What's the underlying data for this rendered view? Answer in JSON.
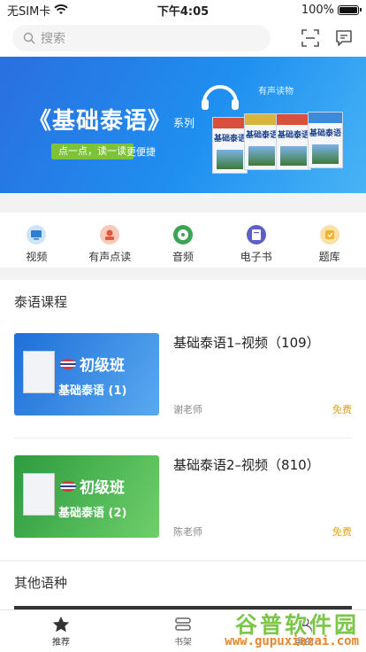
{
  "status": {
    "carrier": "无SIM卡",
    "time": "下午4:05",
    "battery": "100%"
  },
  "search": {
    "placeholder": "搜索"
  },
  "banner": {
    "title": "《基础泰语》",
    "series": "系列",
    "subtitle": "点一点，读一读",
    "easy": "更便捷",
    "audio_label": "有声读物",
    "books": [
      "基础泰语",
      "基础泰语",
      "基础泰语",
      "基础泰语"
    ]
  },
  "categories": [
    {
      "label": "视频",
      "icon": "video-icon",
      "color": "#5aa7e8"
    },
    {
      "label": "有声点读",
      "icon": "audio-reader-icon",
      "color": "#e86a4b"
    },
    {
      "label": "音频",
      "icon": "audio-disc-icon",
      "color": "#3aa655"
    },
    {
      "label": "电子书",
      "icon": "ebook-icon",
      "color": "#5b5fc7"
    },
    {
      "label": "题库",
      "icon": "question-bank-icon",
      "color": "#f2b134"
    }
  ],
  "thai_courses": {
    "title": "泰语课程",
    "items": [
      {
        "title": "基础泰语1–视频（109）",
        "teacher": "谢老师",
        "price": "免费",
        "level": "初级班",
        "book": "基础泰语 (1)",
        "thumb_color": "#1e6fd9"
      },
      {
        "title": "基础泰语2–视频（810）",
        "teacher": "陈老师",
        "price": "免费",
        "level": "初级班",
        "book": "基础泰语 (2)",
        "thumb_color": "#2c9b3f"
      }
    ]
  },
  "other_languages": {
    "title": "其他语种"
  },
  "tabbar": {
    "tabs": [
      {
        "label": "推荐",
        "icon": "star-icon"
      },
      {
        "label": "书架",
        "icon": "bookshelf-icon"
      },
      {
        "label": "我的",
        "icon": "profile-icon"
      }
    ]
  },
  "watermark": {
    "text": "谷普软件园",
    "url": "www.gupuxiazai.com"
  }
}
